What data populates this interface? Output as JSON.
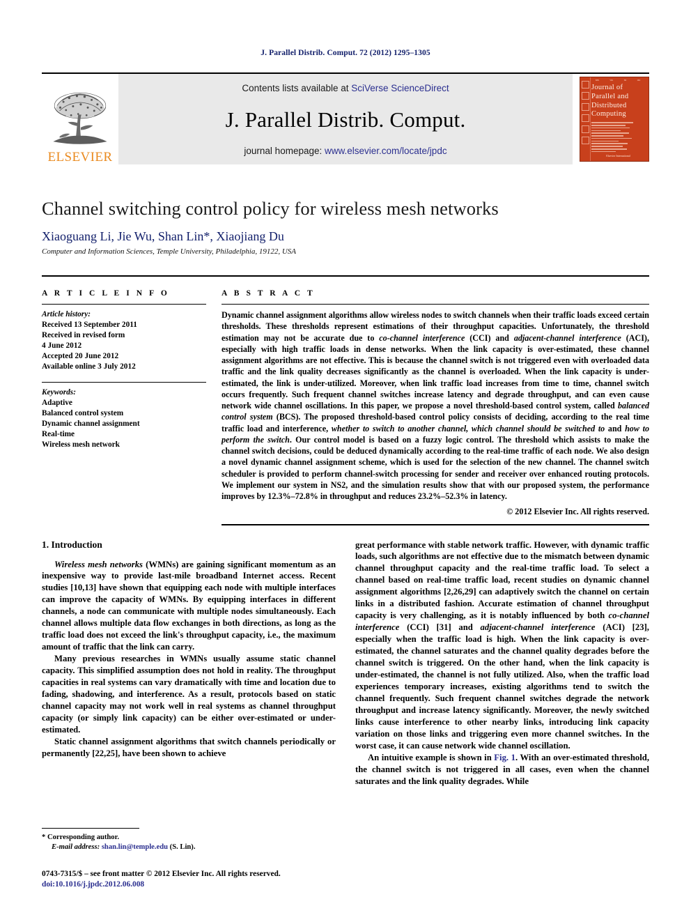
{
  "running_head": "J. Parallel Distrib. Comput. 72 (2012) 1295–1305",
  "masthead": {
    "publisher_word": "ELSEVIER",
    "contents_prefix": "Contents lists available at ",
    "contents_link": "SciVerse ScienceDirect",
    "journal_title": "J. Parallel Distrib. Comput.",
    "homepage_prefix": "journal homepage: ",
    "homepage_link": "www.elsevier.com/locate/jpdc",
    "cover": {
      "line1": "Journal of",
      "line2": "Parallel and",
      "line3": "Distributed",
      "line4": "Computing",
      "footer": "Elsevier International",
      "accent_color": "#c8401c"
    }
  },
  "title_block": {
    "title": "Channel switching control policy for wireless mesh networks",
    "authors": "Xiaoguang Li, Jie Wu, Shan Lin*, Xiaojiang Du",
    "affiliation": "Computer and Information Sciences, Temple University, Philadelphia, 19122, USA",
    "author_color": "#13206b"
  },
  "article_info": {
    "heading": "A R T I C L E   I N F O",
    "history_label": "Article history:",
    "history": [
      "Received 13 September 2011",
      "Received in revised form",
      "4 June 2012",
      "Accepted 20 June 2012",
      "Available online 3 July 2012"
    ],
    "keywords_label": "Keywords:",
    "keywords": [
      "Adaptive",
      "Balanced control system",
      "Dynamic channel assignment",
      "Real-time",
      "Wireless mesh network"
    ]
  },
  "abstract": {
    "heading": "A B S T R A C T",
    "p1": "Dynamic channel assignment algorithms allow wireless nodes to switch channels when their traffic loads exceed certain thresholds. These thresholds represent estimations of their throughput capacities. Unfortunately, the threshold estimation may not be accurate due to ",
    "i1": "co-channel interference",
    "p2": " (CCI) and ",
    "i2": "adjacent-channel interference",
    "p3": " (ACI), especially with high traffic loads in dense networks. When the link capacity is over-estimated, these channel assignment algorithms are not effective. This is because the channel switch is not triggered even with overloaded data traffic and the link quality decreases significantly as the channel is overloaded. When the link capacity is under-estimated, the link is under-utilized. Moreover, when link traffic load increases from time to time, channel switch occurs frequently. Such frequent channel switches increase latency and degrade throughput, and can even cause network wide channel oscillations. In this paper, we propose a novel threshold-based control system, called ",
    "i3": "balanced control system",
    "p4": " (BCS). The proposed threshold-based control policy consists of deciding, according to the real time traffic load and interference, ",
    "i4": "whether to switch to another channel, which channel should be switched to",
    "p5": " and ",
    "i5": "how to perform the switch",
    "p6": ". Our control model is based on a fuzzy logic control. The threshold which assists to make the channel switch decisions, could be deduced dynamically according to the real-time traffic of each node. We also design a novel dynamic channel assignment scheme, which is used for the selection of the new channel. The channel switch scheduler is provided to perform channel-switch processing for sender and receiver over enhanced routing protocols. We implement our system in NS2, and the simulation results show that with our proposed system, the performance improves by 12.3%–72.8% in throughput and reduces 23.2%–52.3% in latency.",
    "copyright": "© 2012 Elsevier Inc. All rights reserved."
  },
  "body": {
    "section_title": "1.  Introduction",
    "left": {
      "p1_lead_italic": "Wireless mesh networks",
      "p1_rest": " (WMNs) are gaining significant momentum as an inexpensive way to provide last-mile broadband Internet access. Recent studies [10,13] have shown that equipping each node with multiple interfaces can improve the capacity of WMNs. By equipping interfaces in different channels, a node can communicate with multiple nodes simultaneously. Each channel allows multiple data flow exchanges in both directions, as long as the traffic load does not exceed the link's throughput capacity, i.e., the maximum amount of traffic that the link can carry.",
      "p2": "Many previous researches in WMNs usually assume static channel capacity. This simplified assumption does not hold in reality. The throughput capacities in real systems can vary dramatically with time and location due to fading, shadowing, and interference. As a result, protocols based on static channel capacity may not work well in real systems as channel throughput capacity (or simply link capacity) can be either over-estimated or under-estimated.",
      "p3": "Static channel assignment algorithms that switch channels periodically or permanently [22,25], have been shown to achieve"
    },
    "right": {
      "p1": "great performance with stable network traffic. However, with dynamic traffic loads, such algorithms are not effective due to the mismatch between dynamic channel throughput capacity and the real-time traffic load. To select a channel based on real-time traffic load, recent studies on dynamic channel assignment algorithms [2,26,29] can adaptively switch the channel on certain links in a distributed fashion. Accurate estimation of channel throughput capacity is very challenging, as it is notably influenced by both ",
      "p1_i1": "co-channel interference",
      "p1_b": " (CCI) [31] and ",
      "p1_i2": "adjacent-channel interference",
      "p1_c": " (ACI) [23], especially when the traffic load is high. When the link capacity is over-estimated, the channel saturates and the channel quality degrades before the channel switch is triggered. On the other hand, when the link capacity is under-estimated, the channel is not fully utilized. Also, when the traffic load experiences temporary increases, existing algorithms tend to switch the channel frequently. Such frequent channel switches degrade the network throughput and increase latency significantly. Moreover, the newly switched links cause interference to other nearby links, introducing link capacity variation on those links and triggering even more channel switches. In the worst case, it can cause network wide channel oscillation.",
      "p2_a": "An intuitive example is shown in ",
      "p2_fig": "Fig. 1",
      "p2_b": ". With an over-estimated threshold, the channel switch is not triggered in all cases, even when the channel saturates and the link quality degrades. While"
    }
  },
  "footnotes": {
    "corresponding_marker": "*",
    "corresponding_text": "Corresponding author.",
    "email_label": "E-mail address:",
    "email": "shan.lin@temple.edu",
    "email_suffix": " (S. Lin).",
    "issn_line": "0743-7315/$ – see front matter © 2012 Elsevier Inc. All rights reserved.",
    "doi": "doi:10.1016/j.jpdc.2012.06.008",
    "link_color": "#13206b"
  }
}
